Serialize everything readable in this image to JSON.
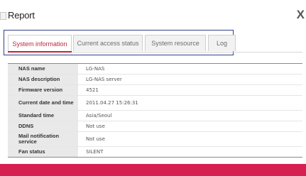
{
  "dialog": {
    "title": "Report",
    "close_label": "X"
  },
  "tabs": [
    {
      "label": "System information",
      "active": true
    },
    {
      "label": "Current access status",
      "active": false
    },
    {
      "label": "System resource",
      "active": false
    },
    {
      "label": "Log",
      "active": false
    }
  ],
  "system_info": [
    {
      "label": "NAS name",
      "value": "LG-NAS"
    },
    {
      "label": "NAS description",
      "value": "LG-NAS server"
    },
    {
      "label": "Firmware version",
      "value": "4521"
    },
    {
      "label": "Current date and time",
      "value": "2011.04.27 15:26:31"
    },
    {
      "label": "Standard time",
      "value": "Asia/Seoul"
    },
    {
      "label": "DDNS",
      "value": "Not use"
    },
    {
      "label": "Mail notification service",
      "value": "Not use"
    },
    {
      "label": "Fan status",
      "value": "SILENT"
    }
  ],
  "colors": {
    "accent": "#c4233a",
    "bottom_bar": "#d62051",
    "tab_focus_outline": "#33418c",
    "label_cell_bg": "#e9e9e9"
  }
}
